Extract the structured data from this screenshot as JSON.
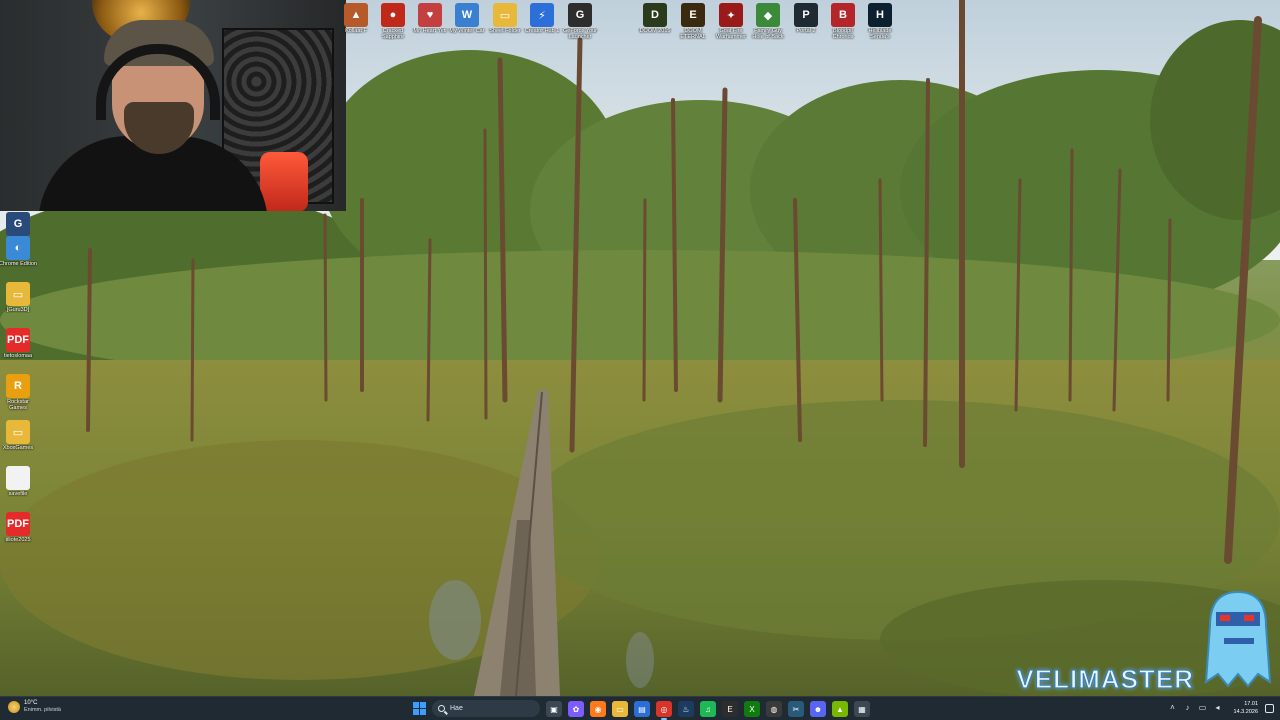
{
  "desktop": {
    "top_icons": [
      {
        "label": "Kollaat F",
        "color": "#b65a2a",
        "glyph": "▲"
      },
      {
        "label": "Cracked Sapphire",
        "color": "#c0281a",
        "glyph": "●"
      },
      {
        "label": "Mr. Heart Yeti",
        "color": "#c43f3f",
        "glyph": "♥"
      },
      {
        "label": "My Winter Car",
        "color": "#3a7fd0",
        "glyph": "W"
      },
      {
        "label": "Sheet Folder",
        "color": "#e8b83a",
        "glyph": "▭"
      },
      {
        "label": "Creator Hub 1",
        "color": "#2c6fd8",
        "glyph": "⚡"
      },
      {
        "label": "GeForce Your Launcher",
        "color": "#2d2d2d",
        "glyph": "G"
      },
      {
        "label": "DOOM 2016",
        "color": "#2a3a1a",
        "glyph": "D"
      },
      {
        "label": "DOOM ETERNAL",
        "color": "#3a2a10",
        "glyph": "E"
      },
      {
        "label": "Goat Fire Warhammer",
        "color": "#9a1a1a",
        "glyph": "✦"
      },
      {
        "label": "Family Guy Hole of Back",
        "color": "#3a8a3a",
        "glyph": "◆"
      },
      {
        "label": "Portal 2",
        "color": "#1f2a33",
        "glyph": "P"
      },
      {
        "label": "Bloodpit Chronos",
        "color": "#b5262b",
        "glyph": "B"
      },
      {
        "label": "Hellblade Senua's",
        "color": "#0d2030",
        "glyph": "H"
      }
    ],
    "left_icons": [
      {
        "label": "Guru3D",
        "color": "#2a4a7a",
        "glyph": "G"
      },
      {
        "label": "Chrome Edition",
        "color": "#3a8ad8",
        "glyph": "◐"
      },
      {
        "label": "[Guru3D]",
        "color": "#e8b83a",
        "glyph": "▭"
      },
      {
        "label": "tietoslomaa",
        "color": "#e52a2a",
        "glyph": "PDF"
      },
      {
        "label": "Rockstar Games",
        "color": "#e8a010",
        "glyph": "R"
      },
      {
        "label": "XboxGames",
        "color": "#e8b83a",
        "glyph": "▭"
      },
      {
        "label": "savefile",
        "color": "#f2f2f2",
        "glyph": ""
      },
      {
        "label": "tiliote2025",
        "color": "#e52a2a",
        "glyph": "PDF"
      }
    ]
  },
  "watermark": {
    "text": "VELIMASTER"
  },
  "taskbar": {
    "weather_temp": "10°C",
    "weather_desc": "Enimm. pilvistä",
    "search_placeholder": "Hae",
    "apps": [
      {
        "name": "task-view",
        "color": "#3b4752",
        "glyph": "▣"
      },
      {
        "name": "copilot",
        "color": "#7b5cff",
        "glyph": "✿"
      },
      {
        "name": "firefox",
        "color": "#ff7a1a",
        "glyph": "◉"
      },
      {
        "name": "file-explorer",
        "color": "#e8b83a",
        "glyph": "▭"
      },
      {
        "name": "store",
        "color": "#2a6fd8",
        "glyph": "▤"
      },
      {
        "name": "browser",
        "color": "#d8342a",
        "glyph": "◎"
      },
      {
        "name": "steam",
        "color": "#1b3b60",
        "glyph": "♨"
      },
      {
        "name": "spotify",
        "color": "#1db954",
        "glyph": "♫"
      },
      {
        "name": "epic",
        "color": "#2d2d2d",
        "glyph": "E"
      },
      {
        "name": "xbox",
        "color": "#107c10",
        "glyph": "X"
      },
      {
        "name": "obs",
        "color": "#3a3a3a",
        "glyph": "◍"
      },
      {
        "name": "tools",
        "color": "#2a5a7a",
        "glyph": "✂"
      },
      {
        "name": "discord",
        "color": "#5865f2",
        "glyph": "☻"
      },
      {
        "name": "nvidia",
        "color": "#76b900",
        "glyph": "▲"
      },
      {
        "name": "calculator",
        "color": "#3b4752",
        "glyph": "▦"
      }
    ],
    "clock_time": "17.01",
    "clock_date": "14.3.2026"
  }
}
